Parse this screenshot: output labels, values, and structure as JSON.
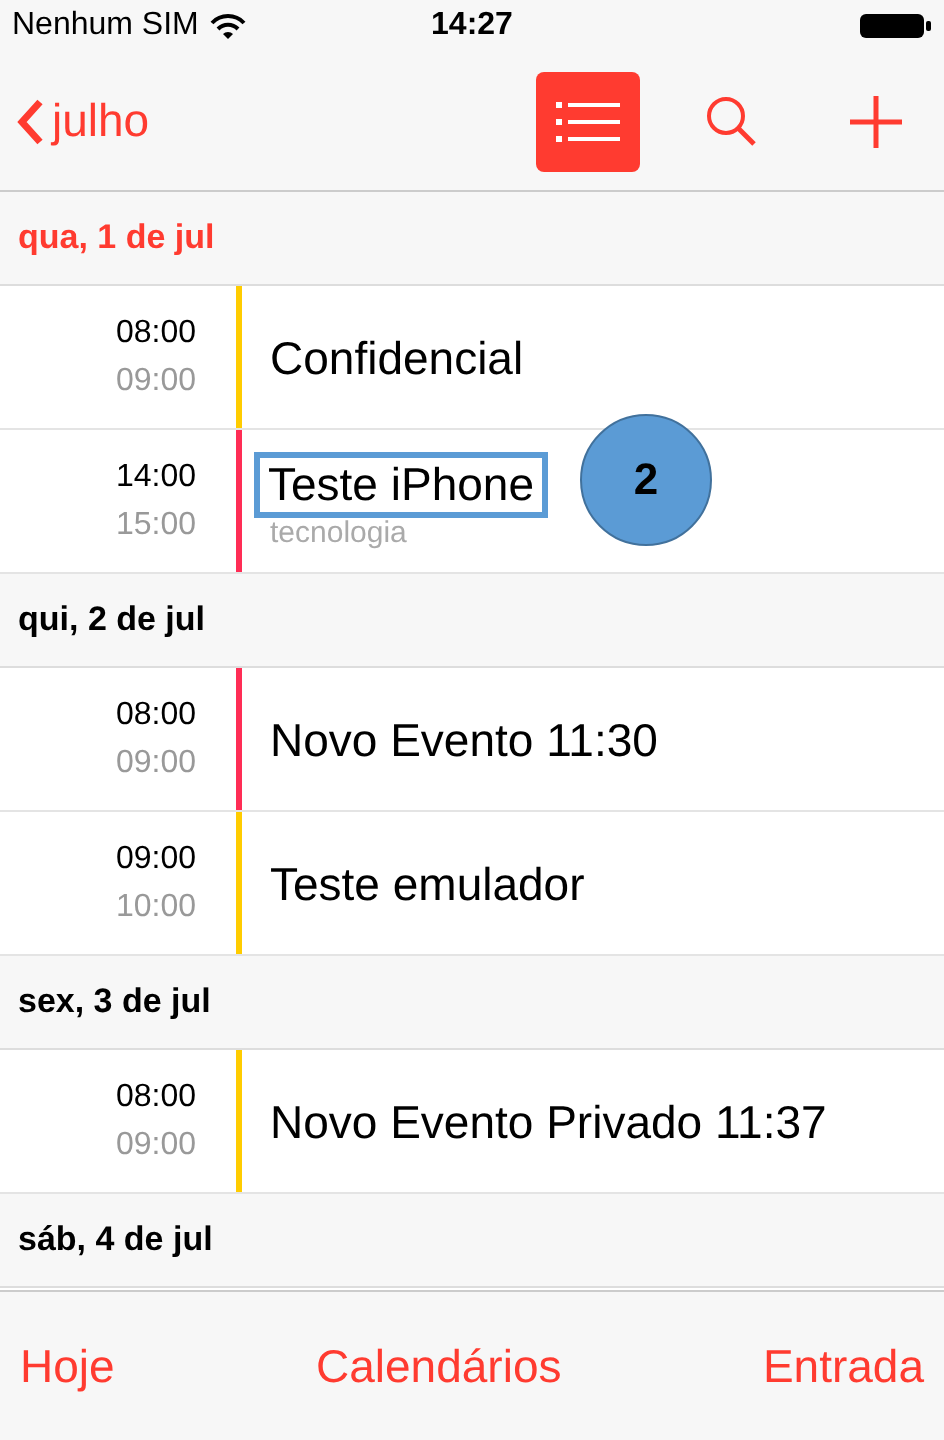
{
  "status_bar": {
    "carrier": "Nenhum SIM",
    "time": "14:27"
  },
  "nav_bar": {
    "back_label": "julho",
    "list_view_selected": true
  },
  "days": [
    {
      "header": "qua, 1 de jul",
      "today": true,
      "events": [
        {
          "start": "08:00",
          "end": "09:00",
          "title": "Confidencial",
          "color": "#ffcc00"
        },
        {
          "start": "14:00",
          "end": "15:00",
          "title": "Teste iPhone",
          "subtitle": "tecnologia",
          "color": "#ff2d55",
          "highlighted": true
        }
      ]
    },
    {
      "header": "qui, 2 de jul",
      "today": false,
      "events": [
        {
          "start": "08:00",
          "end": "09:00",
          "title": "Novo Evento 11:30",
          "color": "#ff2d55"
        },
        {
          "start": "09:00",
          "end": "10:00",
          "title": "Teste emulador",
          "color": "#ffcc00"
        }
      ]
    },
    {
      "header": "sex, 3 de jul",
      "today": false,
      "events": [
        {
          "start": "08:00",
          "end": "09:00",
          "title": "Novo Evento Privado 11:37",
          "color": "#ffcc00"
        }
      ]
    },
    {
      "header": "sáb, 4 de jul",
      "today": false
    }
  ],
  "annotation": {
    "label": "2"
  },
  "tab_bar": [
    "Hoje",
    "Calendários",
    "Entrada"
  ]
}
